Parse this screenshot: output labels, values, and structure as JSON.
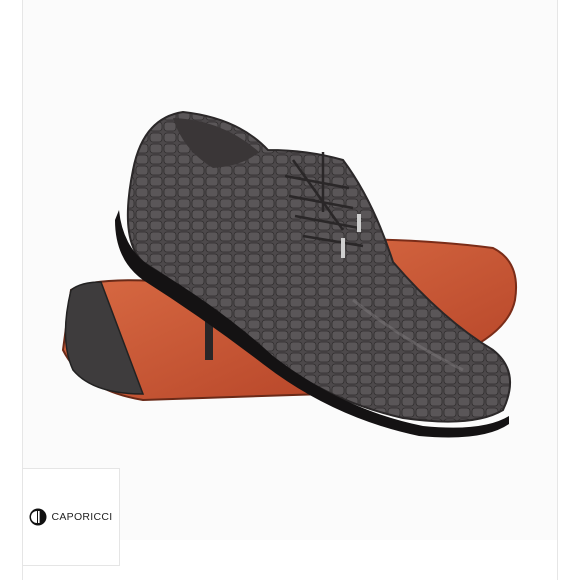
{
  "product_image": {
    "subject": "shoes-photo",
    "colors": {
      "leather": "#4a4648",
      "sole": "#cc5a35",
      "heel_rubber": "#3e3c3d",
      "background": "#fbfbfb"
    }
  },
  "brand": {
    "name": "CAPORICCI",
    "logo_icon": "caporicci-logo-icon"
  }
}
